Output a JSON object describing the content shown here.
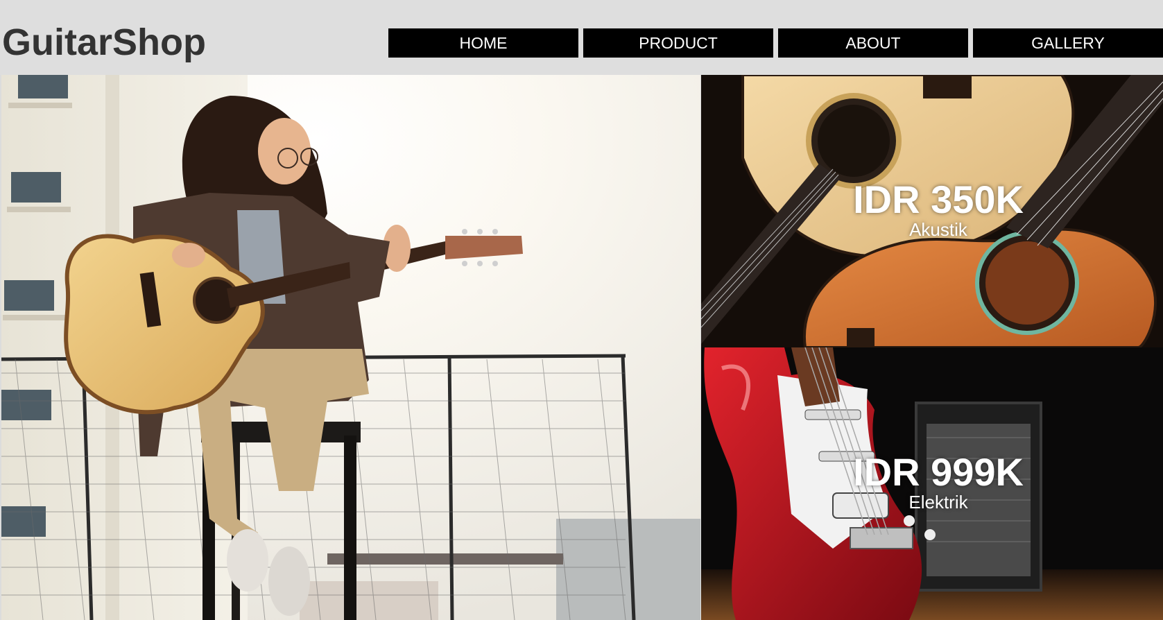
{
  "brand": "GuitarShop",
  "nav": [
    "HOME",
    "PRODUCT",
    "ABOUT",
    "GALLERY"
  ],
  "products": [
    {
      "price": "IDR 350K",
      "category": "Akustik"
    },
    {
      "price": "IDR 999K",
      "category": "Elektrik"
    }
  ],
  "images": {
    "hero": "girl-playing-acoustic-guitar-photo",
    "acoustic": "acoustic-guitars-photo",
    "electric": "red-electric-guitar-photo"
  }
}
